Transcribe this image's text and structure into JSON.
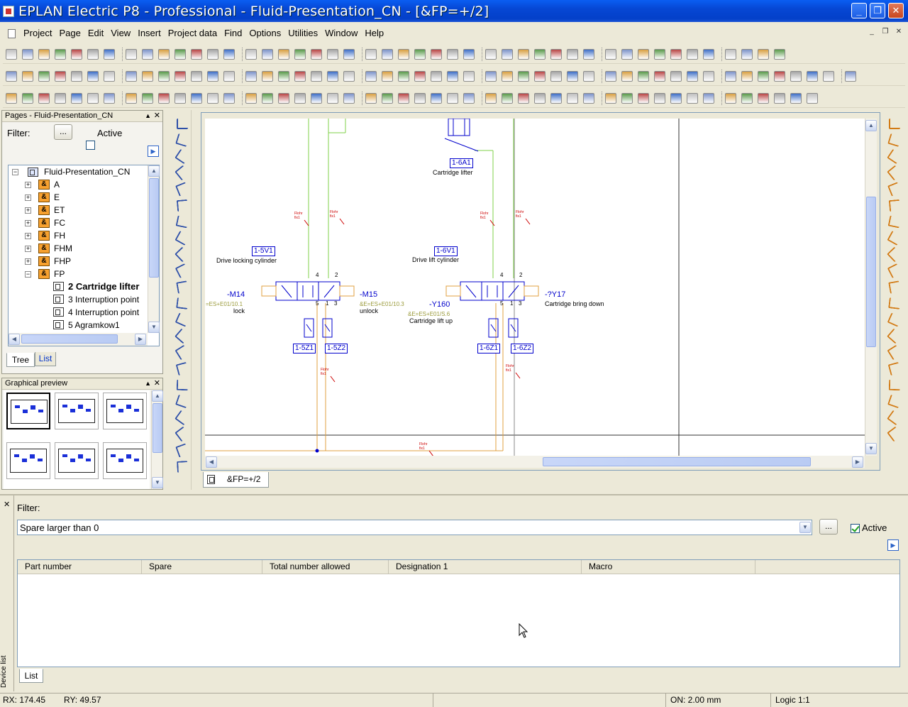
{
  "window": {
    "title": "EPLAN Electric P8 - Professional - Fluid-Presentation_CN - [&FP=+/2]"
  },
  "menu": [
    "Project",
    "Page",
    "Edit",
    "View",
    "Insert",
    "Project data",
    "Find",
    "Options",
    "Utilities",
    "Window",
    "Help"
  ],
  "pages_panel": {
    "title": "Pages - Fluid-Presentation_CN",
    "filter_label": "Filter:",
    "filter_button": "...",
    "active_label": "Active",
    "root": "Fluid-Presentation_CN",
    "nodes": [
      "A",
      "E",
      "ET",
      "FC",
      "FH",
      "FHM",
      "FHP",
      "FP"
    ],
    "node_icon": "&",
    "pages": [
      "2 Cartridge lifter",
      "3 Interruption point",
      "4 Interruption point",
      "5 Agramkow1"
    ],
    "tabs": [
      "Tree",
      "List"
    ]
  },
  "preview_panel": {
    "title": "Graphical preview"
  },
  "editor": {
    "tab": "&FP=+/2",
    "labels": {
      "a1": "1-6A1",
      "a1_desc": "Cartridge lifter",
      "v5": "1-5V1",
      "v5_desc": "Drive locking cylinder",
      "v6": "1-6V1",
      "v6_desc": "Drive lift cylinder",
      "m14": "-M14",
      "m14_ref": "=ES+E01/10.1",
      "m14_desc": "lock",
      "m15": "-M15",
      "m15_ref": "&E=ES+E01/10.3",
      "m15_desc": "unlock",
      "y160": "-Y160",
      "y160_ref": "&E=ES+E01/S.6",
      "y160_desc": "Cartridge lift up",
      "y17": "-?Y17",
      "y17_desc": "Cartridge bring down",
      "z51": "1-5Z1",
      "z52": "1-5Z2",
      "z61": "1-6Z1",
      "z62": "1-6Z2",
      "port4": "4",
      "port2": "2",
      "port5": "5",
      "port1": "1",
      "port3": "3",
      "flow": "Flohr",
      "flow2": "fix1"
    }
  },
  "device_list": {
    "filter_label": "Filter:",
    "filter_value": "Spare larger than 0",
    "filter_button": "...",
    "active_label": "Active",
    "side_label": "Device list",
    "columns": [
      "Part number",
      "Spare",
      "Total number allowed",
      "Designation 1",
      "Macro"
    ],
    "tab": "List"
  },
  "status": {
    "rx": "RX:  174.45",
    "ry": "RY:  49.57",
    "on": "ON: 2.00 mm",
    "logic": "Logic 1:1"
  }
}
